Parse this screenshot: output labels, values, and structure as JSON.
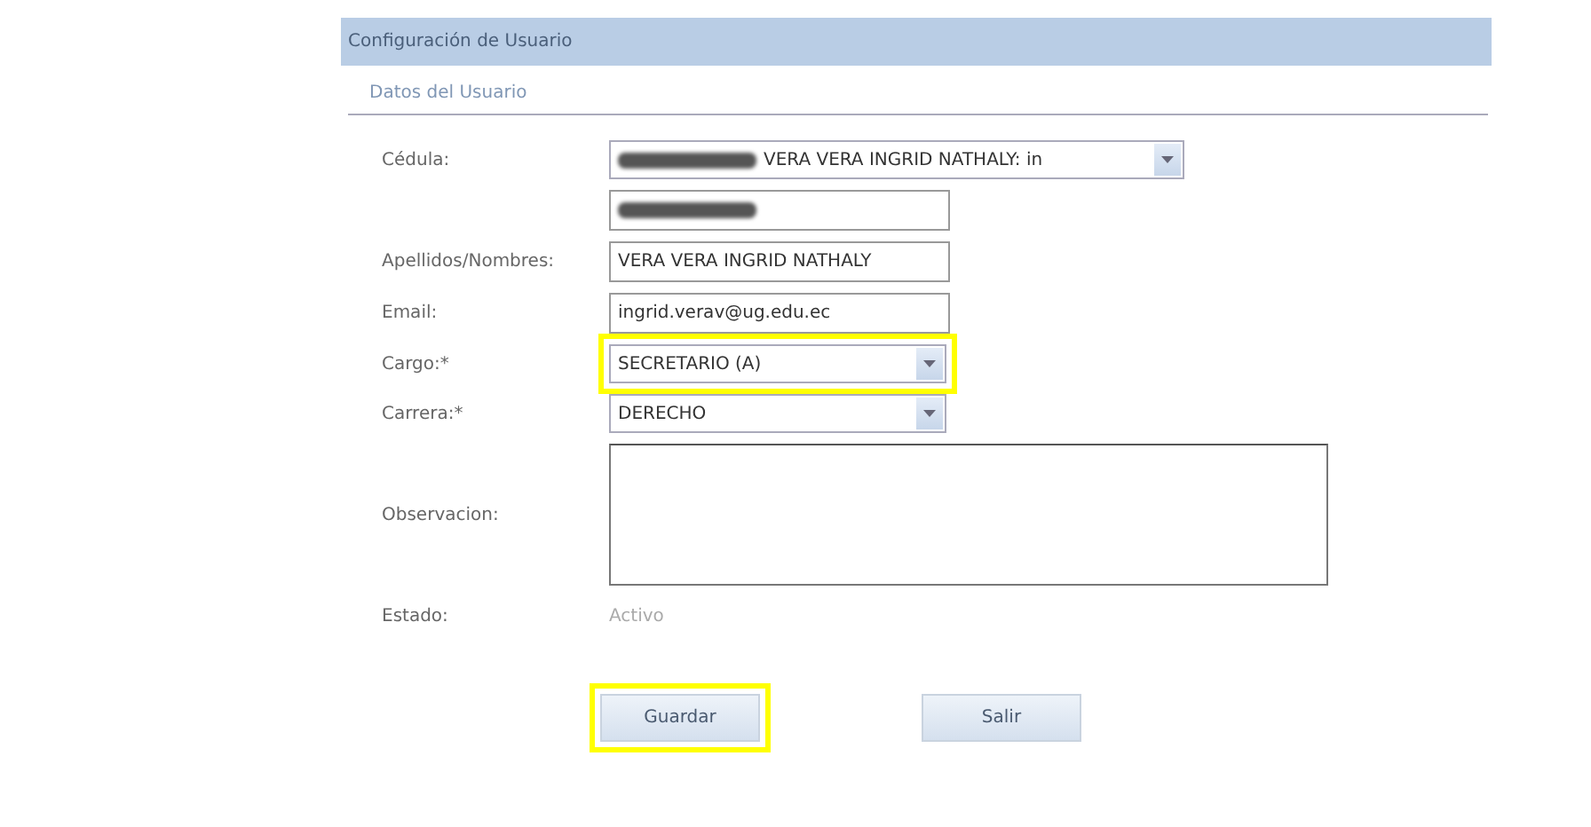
{
  "window": {
    "title": "Configuración de Usuario"
  },
  "section": {
    "title": "Datos del Usuario"
  },
  "fields": [
    {
      "kind": "combo",
      "label": "Cédula:",
      "value": "VERA VERA INGRID NATHALY: in",
      "redacted": true,
      "highlighted": false
    },
    {
      "kind": "text",
      "redacted": true,
      "highlighted": false
    },
    {
      "kind": "text",
      "label": "Apellidos/Nombres:",
      "value": "VERA VERA INGRID NATHALY",
      "highlighted": false
    },
    {
      "kind": "text",
      "label": "Email:",
      "value": "ingrid.verav@ug.edu.ec",
      "highlighted": false
    },
    {
      "kind": "combo",
      "label": "Cargo:*",
      "value": "SECRETARIO (A)",
      "highlighted": true
    },
    {
      "kind": "combo",
      "label": "Carrera:*",
      "value": "DERECHO",
      "highlighted": false
    },
    {
      "kind": "area",
      "label": "Observacion:",
      "highlighted": false
    },
    {
      "kind": "static",
      "label": "Estado:",
      "value": "Activo",
      "highlighted": false
    }
  ],
  "buttons": [
    {
      "label": "Guardar",
      "highlighted": true
    },
    {
      "label": "Salir",
      "highlighted": false
    }
  ]
}
